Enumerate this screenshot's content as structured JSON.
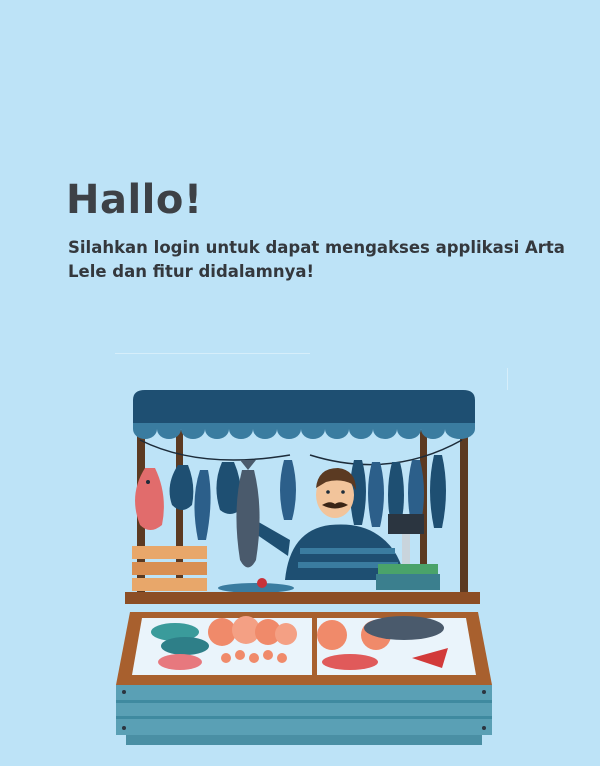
{
  "greeting": {
    "title": "Hallo!",
    "message": "Silahkan login untuk dapat mengakses applikasi Arta Lele dan fitur didalamnya!"
  },
  "colors": {
    "background": "#bde3f7",
    "heading_text": "#3d4146",
    "awning": "#1e4f72",
    "stall_wood": "#a8602e",
    "counter_teal": "#5aa0b5",
    "fish_blue": "#2c5f8a",
    "salmon": "#f08a6a"
  },
  "illustration": {
    "name": "fish-market-stall-illustration"
  }
}
